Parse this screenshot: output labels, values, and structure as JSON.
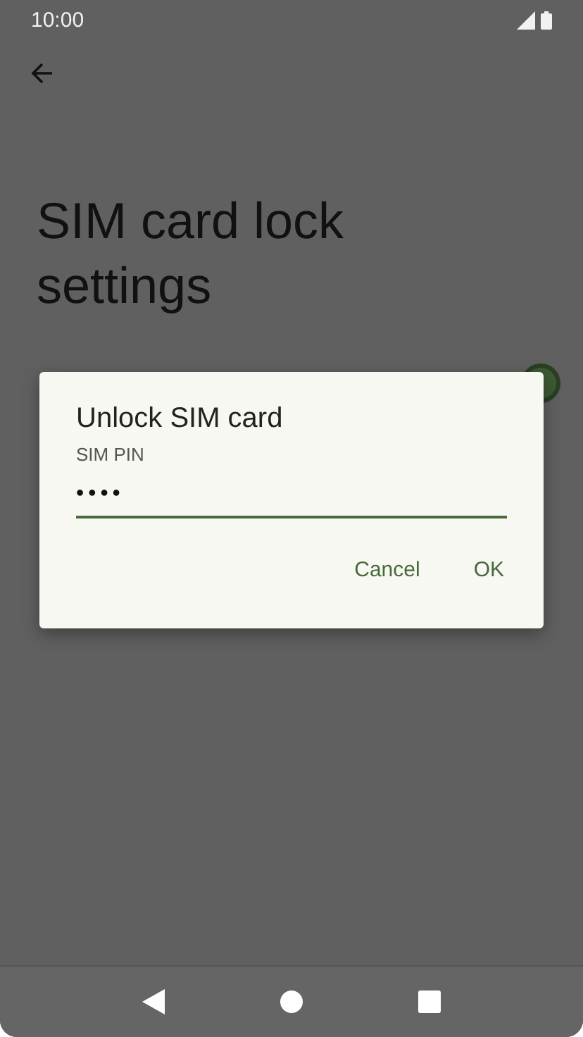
{
  "status_bar": {
    "time": "10:00"
  },
  "page": {
    "title": "SIM card lock settings",
    "toggle": {
      "on": true
    }
  },
  "dialog": {
    "title": "Unlock SIM card",
    "field_label": "SIM PIN",
    "value": "••••",
    "buttons": [
      "Cancel",
      "OK"
    ]
  }
}
